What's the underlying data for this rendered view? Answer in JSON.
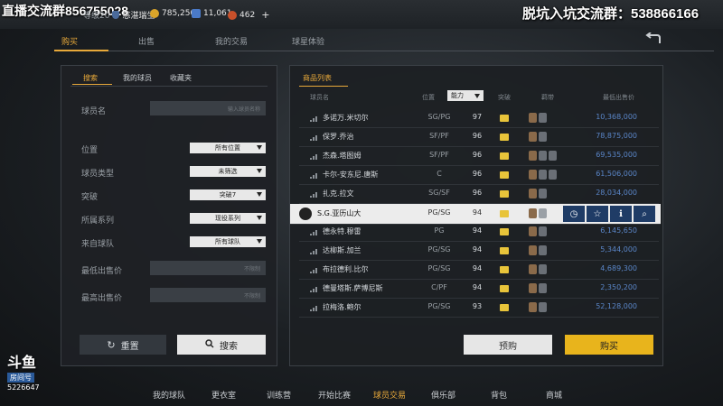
{
  "overlay": {
    "left_text": "直播交流群856755028",
    "right_text": "脱坑入坑交流群：538866166"
  },
  "topbar": {
    "player_tag": "等级20",
    "team_name": "慈湛瑞生",
    "gold": "785,250",
    "silver": "11,061",
    "tickets": "462",
    "plus": "+"
  },
  "nav": {
    "tabs": [
      "购买",
      "出售",
      "我的交易",
      "球星体验"
    ],
    "active_index": 0
  },
  "filters": {
    "tabs": [
      "搜索",
      "我的球员",
      "收藏夹"
    ],
    "name_label": "球员名",
    "name_placeholder": "输入球员名称",
    "rows": [
      {
        "label": "位置",
        "value": "所有位置"
      },
      {
        "label": "球员类型",
        "value": "未筛选"
      },
      {
        "label": "突破",
        "value": "突破7"
      },
      {
        "label": "所属系列",
        "value": "现役系列"
      },
      {
        "label": "来自球队",
        "value": "所有球队"
      }
    ],
    "min_price_label": "最低出售价",
    "max_price_label": "最高出售价",
    "price_placeholder": "不限制",
    "reset_label": "重置",
    "search_label": "搜索"
  },
  "list": {
    "tab_label": "商品列表",
    "headers": {
      "name": "球员名",
      "position": "位置",
      "ability": "能力",
      "breakthrough": "突破",
      "ovr": "羁带",
      "price": "最低出售价"
    },
    "rows": [
      {
        "name": "多诺万.米切尔",
        "position": "SG/PG",
        "ovr": "97",
        "price": "10,368,000",
        "badges": [
          "#8a6a4a",
          "#6a6f76"
        ]
      },
      {
        "name": "保罗.乔治",
        "position": "SF/PF",
        "ovr": "96",
        "price": "78,875,000",
        "badges": [
          "#8a6a4a",
          "#6a6f76"
        ]
      },
      {
        "name": "杰森.塔图姆",
        "position": "SF/PF",
        "ovr": "96",
        "price": "69,535,000",
        "badges": [
          "#8a6a4a",
          "#6a6f76",
          "#6a6f76"
        ]
      },
      {
        "name": "卡尔-安东尼.唐斯",
        "position": "C",
        "ovr": "96",
        "price": "61,506,000",
        "badges": [
          "#8a6a4a",
          "#6a6f76",
          "#6a6f76"
        ]
      },
      {
        "name": "扎克.拉文",
        "position": "SG/SF",
        "ovr": "96",
        "price": "28,034,000",
        "badges": [
          "#8a6a4a",
          "#6a6f76"
        ]
      },
      {
        "name": "S.G.亚历山大",
        "position": "PG/SG",
        "ovr": "94",
        "price": "",
        "badges": [
          "#8a6a4a",
          "#9aa0a6"
        ],
        "selected": true
      },
      {
        "name": "德永特.穆雷",
        "position": "PG",
        "ovr": "94",
        "price": "6,145,650",
        "badges": [
          "#8a6a4a",
          "#6a6f76"
        ]
      },
      {
        "name": "达柳斯.加兰",
        "position": "PG/SG",
        "ovr": "94",
        "price": "5,344,000",
        "badges": [
          "#8a6a4a",
          "#6a6f76"
        ]
      },
      {
        "name": "布拉德利.比尔",
        "position": "PG/SG",
        "ovr": "94",
        "price": "4,689,300",
        "badges": [
          "#8a6a4a",
          "#6a6f76"
        ]
      },
      {
        "name": "德曼塔斯.萨博尼斯",
        "position": "C/PF",
        "ovr": "94",
        "price": "2,350,200",
        "badges": [
          "#8a6a4a",
          "#6a6f76"
        ]
      },
      {
        "name": "拉梅洛.鲍尔",
        "position": "PG/SG",
        "ovr": "93",
        "price": "52,128,000",
        "badges": [
          "#8a6a4a",
          "#6a6f76"
        ]
      }
    ],
    "presale_label": "预购",
    "buy_label": "购买"
  },
  "logo": {
    "brand": "斗鱼",
    "sub": "房间号",
    "room": "5226647"
  },
  "bottom_nav": {
    "items": [
      "我的球队",
      "更衣室",
      "训练营",
      "开始比赛",
      "球员交易",
      "俱乐部",
      "背包",
      "商城"
    ],
    "active_index": 4
  },
  "colors": {
    "accent": "#e8a93a",
    "buy_button": "#e8b41c",
    "price_blue": "#5a86c8",
    "selected_action": "#1f3c66"
  }
}
